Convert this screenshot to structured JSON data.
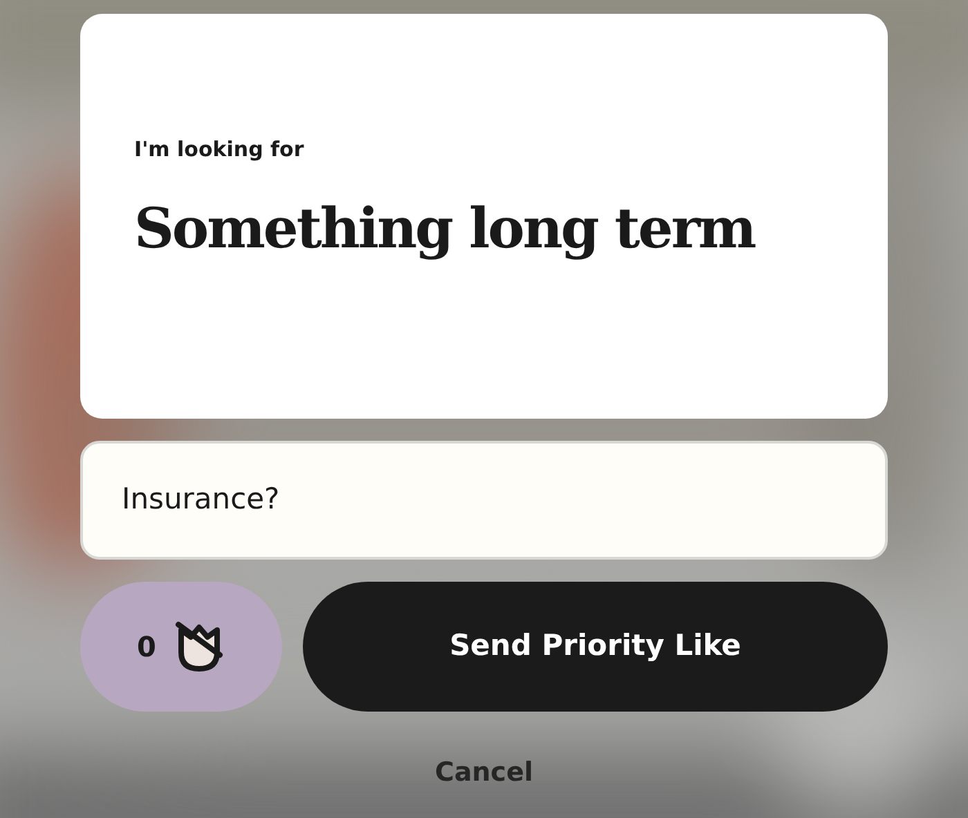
{
  "prompt_card": {
    "label": "I'm looking for",
    "answer": "Something long term"
  },
  "comment_field": {
    "value": "Insurance?"
  },
  "rose_button": {
    "count": "0"
  },
  "send_button": {
    "label": "Send Priority Like"
  },
  "cancel_link": {
    "label": "Cancel"
  }
}
